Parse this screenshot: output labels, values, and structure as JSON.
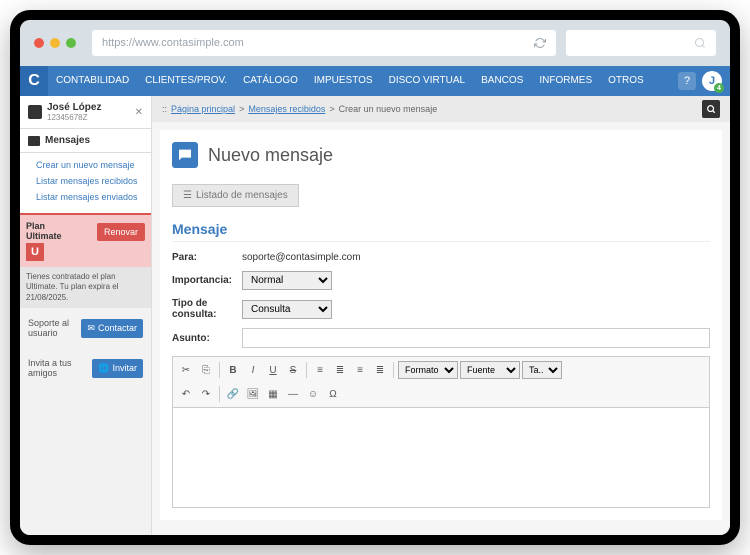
{
  "browser": {
    "url": "https://www.contasimple.com"
  },
  "nav": {
    "logo": "C",
    "items": [
      "CONTABILIDAD",
      "CLIENTES/PROV.",
      "CATÁLOGO",
      "IMPUESTOS",
      "DISCO VIRTUAL",
      "BANCOS",
      "INFORMES",
      "OTROS"
    ],
    "avatar_initial": "J",
    "avatar_badge": "4"
  },
  "sidebar": {
    "user": {
      "name": "José López",
      "id": "12345678Z"
    },
    "section": "Mensajes",
    "links": [
      "Crear un nuevo mensaje",
      "Listar mensajes recibidos",
      "Listar mensajes enviados"
    ],
    "plan": {
      "line1": "Plan",
      "line2": "Ultimate",
      "badge": "U",
      "renew": "Renovar",
      "note": "Tienes contratado el plan Ultimate. Tu plan expira el 21/08/2025."
    },
    "support": {
      "label": "Soporte al usuario",
      "btn": "Contactar"
    },
    "invite": {
      "label": "Invita a tus amigos",
      "btn": "Invitar"
    }
  },
  "breadcrumb": {
    "prefix": "::",
    "home": "Página principal",
    "sep": ">",
    "mid": "Mensajes recibidos",
    "current": "Crear un nuevo mensaje"
  },
  "page": {
    "title": "Nuevo mensaje",
    "list_btn": "Listado de mensajes"
  },
  "form": {
    "section": "Mensaje",
    "to_label": "Para:",
    "to_value": "soporte@contasimple.com",
    "importance_label": "Importancia:",
    "importance_value": "Normal",
    "type_label": "Tipo de consulta:",
    "type_value": "Consulta",
    "subject_label": "Asunto:"
  },
  "editor": {
    "format": "Formato",
    "font": "Fuente",
    "size": "Ta..."
  }
}
